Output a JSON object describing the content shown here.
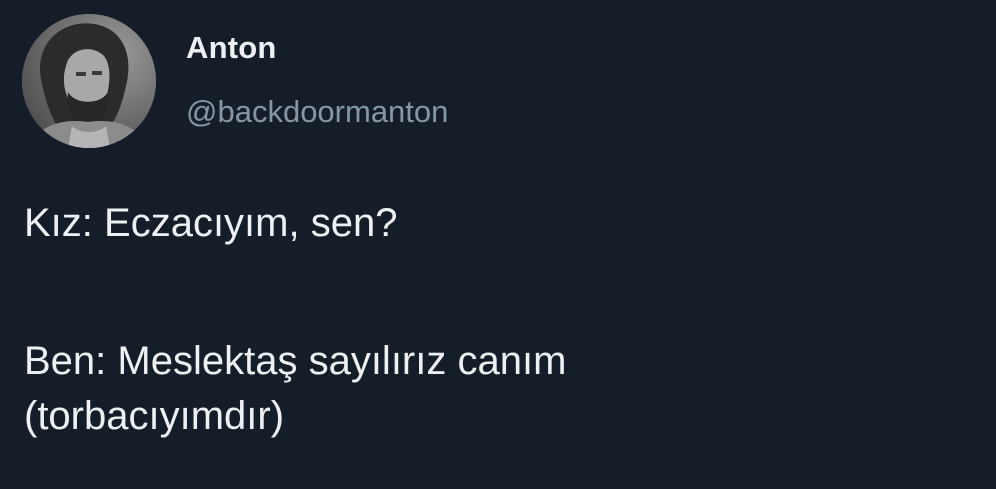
{
  "author": {
    "display_name": "Anton",
    "handle": "@backdoormanton",
    "avatar_icon": "bearded-man-photo"
  },
  "tweet": {
    "paragraphs": [
      [
        "Kız: Eczacıyım, sen?"
      ],
      [
        "Ben: Meslektaş sayılırız canım",
        "(torbacıyımdır)"
      ]
    ]
  },
  "colors": {
    "background": "#151e28",
    "text": "#eef1f4",
    "handle": "#8796a5"
  }
}
